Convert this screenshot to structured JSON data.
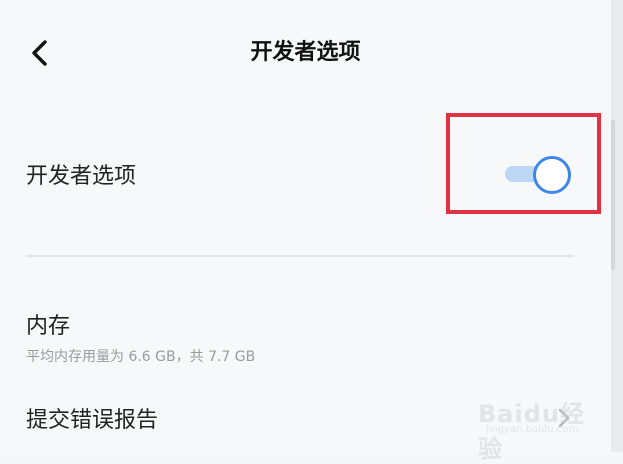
{
  "header": {
    "title": "开发者选项",
    "back_icon": "chevron-left-icon"
  },
  "developer_options": {
    "label": "开发者选项",
    "toggle_on": true,
    "toggle_color": "#3b86e6",
    "highlight_color": "#e03145"
  },
  "memory": {
    "title": "内存",
    "subtitle": "平均内存用量为 6.6 GB，共 7.7 GB"
  },
  "bug_report": {
    "title": "提交错误报告",
    "chevron_icon": "chevron-right-icon"
  },
  "watermark": {
    "text": "Baidu经验",
    "sub": "jingyan.baidu.com"
  }
}
